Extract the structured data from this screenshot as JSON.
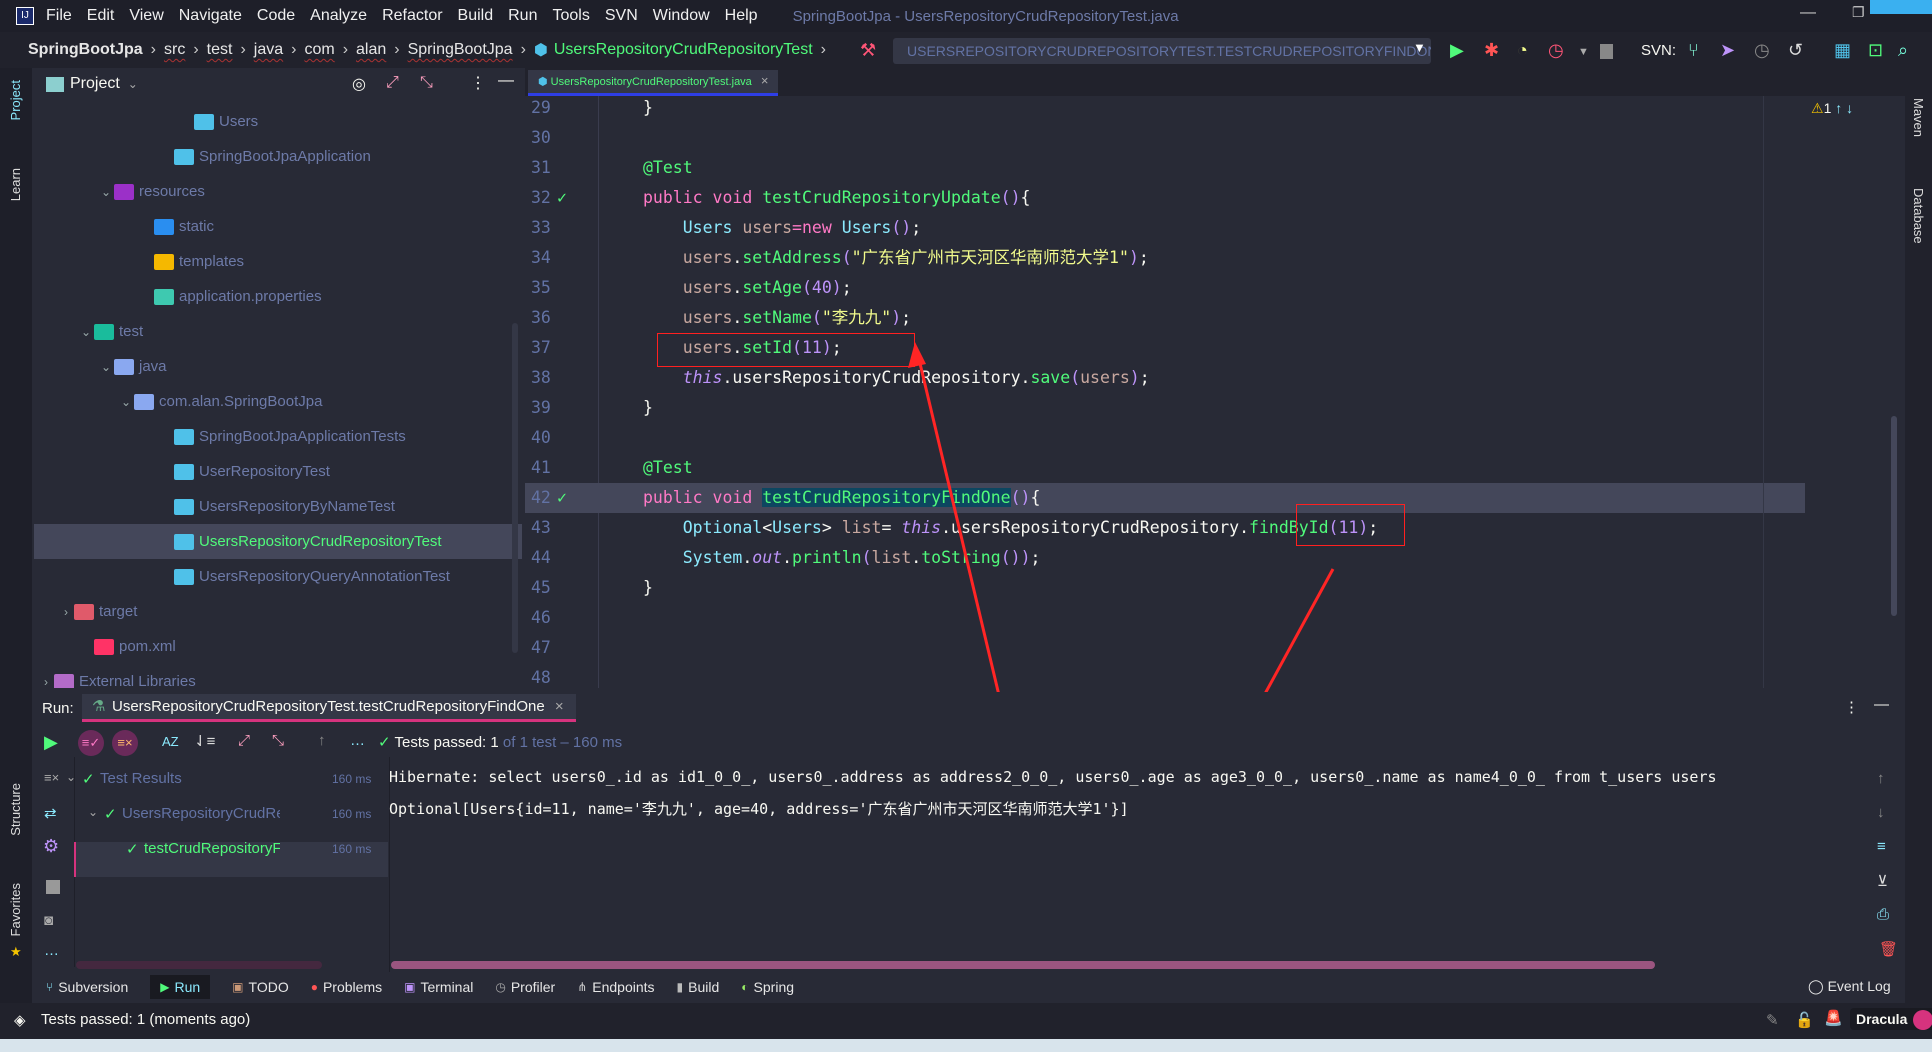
{
  "menu": {
    "items": [
      "File",
      "Edit",
      "View",
      "Navigate",
      "Code",
      "Analyze",
      "Refactor",
      "Build",
      "Run",
      "Tools",
      "SVN",
      "Window",
      "Help"
    ],
    "window_title": "SpringBootJpa - UsersRepositoryCrudRepositoryTest.java"
  },
  "breadcrumb": [
    "SpringBootJpa",
    "src",
    "test",
    "java",
    "com",
    "alan",
    "SpringBootJpa",
    "UsersRepositoryCrudRepositoryTest"
  ],
  "toolbar": {
    "run_config": "USERSREPOSITORYCRUDREPOSITORYTEST.TESTCRUDREPOSITORYFINDONE",
    "svn_label": "SVN:"
  },
  "left_stripe": {
    "project": "Project",
    "learn": "Learn",
    "structure": "Structure",
    "favorites": "Favorites"
  },
  "right_stripe": {
    "maven": "Maven",
    "database": "Database"
  },
  "project": {
    "title": "Project",
    "items": [
      {
        "label": "Users",
        "indent": 7,
        "icon": "class-icon",
        "color": "#4fc1e9"
      },
      {
        "label": "SpringBootJpaApplication",
        "indent": 6,
        "icon": "spring-class-icon",
        "color": "#4fc1e9"
      },
      {
        "label": "resources",
        "indent": 3,
        "chev": "v",
        "icon": "resources-folder-icon",
        "color": "#9b30c8"
      },
      {
        "label": "static",
        "indent": 5,
        "icon": "web-folder-icon",
        "color": "#2a8ef0"
      },
      {
        "label": "templates",
        "indent": 5,
        "icon": "templates-folder-icon",
        "color": "#f5b800"
      },
      {
        "label": "application.properties",
        "indent": 5,
        "icon": "properties-file-icon",
        "color": "#3ec9b0"
      },
      {
        "label": "test",
        "indent": 2,
        "chev": "v",
        "icon": "test-folder-icon",
        "color": "#1abc9c"
      },
      {
        "label": "java",
        "indent": 3,
        "chev": "v",
        "icon": "folder-icon",
        "color": "#8aa8f0"
      },
      {
        "label": "com.alan.SpringBootJpa",
        "indent": 4,
        "chev": "v",
        "icon": "package-icon",
        "color": "#8aa8f0"
      },
      {
        "label": "SpringBootJpaApplicationTests",
        "indent": 6,
        "icon": "test-class-icon",
        "color": "#4fc1e9"
      },
      {
        "label": "UserRepositoryTest",
        "indent": 6,
        "icon": "test-class-icon",
        "color": "#4fc1e9"
      },
      {
        "label": "UsersRepositoryByNameTest",
        "indent": 6,
        "icon": "test-class-icon",
        "color": "#4fc1e9"
      },
      {
        "label": "UsersRepositoryCrudRepositoryTest",
        "indent": 6,
        "icon": "test-class-icon",
        "color": "#4fc1e9",
        "selected": true
      },
      {
        "label": "UsersRepositoryQueryAnnotationTest",
        "indent": 6,
        "icon": "test-class-icon",
        "color": "#4fc1e9"
      },
      {
        "label": "target",
        "indent": 1,
        "chev": ">",
        "icon": "target-folder-icon",
        "color": "#e05a6a"
      },
      {
        "label": "pom.xml",
        "indent": 2,
        "icon": "maven-icon",
        "color": "#ff3366"
      },
      {
        "label": "External Libraries",
        "indent": 0,
        "chev": ">",
        "icon": "library-icon",
        "color": "#b36bc8"
      }
    ]
  },
  "editor": {
    "tab": "UsersRepositoryCrudRepositoryTest.java",
    "warnings": "1",
    "lines": [
      {
        "n": "29",
        "t": [
          [
            "p",
            "}"
          ]
        ]
      },
      {
        "n": "30",
        "t": []
      },
      {
        "n": "31",
        "t": [
          [
            "a",
            "@Test"
          ]
        ]
      },
      {
        "n": "32",
        "t": [
          [
            "k",
            "public void "
          ],
          [
            "f",
            "testCrudRepositoryUpdate"
          ],
          [
            "n",
            "()"
          ],
          [
            "p",
            "{"
          ]
        ],
        "mark": true
      },
      {
        "n": "33",
        "t": [
          [
            "c",
            "    Users "
          ],
          [
            "v",
            "users"
          ],
          [
            "k",
            "=new "
          ],
          [
            "c",
            "Users"
          ],
          [
            "n",
            "()"
          ],
          [
            "p",
            ";"
          ]
        ]
      },
      {
        "n": "34",
        "t": [
          [
            "v",
            "    users"
          ],
          [
            "p",
            "."
          ],
          [
            "f",
            "setAddress"
          ],
          [
            "n",
            "("
          ],
          [
            "s",
            "\"广东省广州市天河区华南师范大学1\""
          ],
          [
            "n",
            ")"
          ],
          [
            "p",
            ";"
          ]
        ]
      },
      {
        "n": "35",
        "t": [
          [
            "v",
            "    users"
          ],
          [
            "p",
            "."
          ],
          [
            "f",
            "setAge"
          ],
          [
            "n",
            "(40)"
          ],
          [
            "p",
            ";"
          ]
        ]
      },
      {
        "n": "36",
        "t": [
          [
            "v",
            "    users"
          ],
          [
            "p",
            "."
          ],
          [
            "f",
            "setName"
          ],
          [
            "n",
            "("
          ],
          [
            "s",
            "\"李九九\""
          ],
          [
            "n",
            ")"
          ],
          [
            "p",
            ";"
          ]
        ]
      },
      {
        "n": "37",
        "t": [
          [
            "v",
            "    users"
          ],
          [
            "p",
            "."
          ],
          [
            "f",
            "setId"
          ],
          [
            "n",
            "(11)"
          ],
          [
            "p",
            ";"
          ]
        ]
      },
      {
        "n": "38",
        "t": [
          [
            "i",
            "    this"
          ],
          [
            "p",
            ".usersRepositoryCrudRepository."
          ],
          [
            "f",
            "save"
          ],
          [
            "n",
            "("
          ],
          [
            "v",
            "users"
          ],
          [
            "n",
            ")"
          ],
          [
            "p",
            ";"
          ]
        ]
      },
      {
        "n": "39",
        "t": [
          [
            "p",
            "}"
          ]
        ]
      },
      {
        "n": "40",
        "t": []
      },
      {
        "n": "41",
        "t": [
          [
            "a",
            "@Test"
          ]
        ]
      },
      {
        "n": "42",
        "t": [
          [
            "k",
            "public void "
          ],
          [
            "f sel",
            "testCrudRepositoryFindOne"
          ],
          [
            "n",
            "()"
          ],
          [
            "p",
            "{"
          ]
        ],
        "mark": true,
        "highlight": true
      },
      {
        "n": "43",
        "t": [
          [
            "c",
            "    Optional"
          ],
          [
            "p",
            "<"
          ],
          [
            "c",
            "Users"
          ],
          [
            "p",
            "> "
          ],
          [
            "v",
            "list"
          ],
          [
            "p",
            "= "
          ],
          [
            "i",
            "this"
          ],
          [
            "p",
            ".usersRepositoryCrudRepository."
          ],
          [
            "f",
            "findById"
          ],
          [
            "n",
            "(11)"
          ],
          [
            "p",
            ";"
          ]
        ]
      },
      {
        "n": "44",
        "t": [
          [
            "c",
            "    System"
          ],
          [
            "p",
            "."
          ],
          [
            "i",
            "out"
          ],
          [
            "p",
            "."
          ],
          [
            "f",
            "println"
          ],
          [
            "n",
            "("
          ],
          [
            "v",
            "list"
          ],
          [
            "p",
            "."
          ],
          [
            "f",
            "toString"
          ],
          [
            "n",
            "()"
          ],
          [
            "n",
            ")"
          ],
          [
            "p",
            ";"
          ]
        ]
      },
      {
        "n": "45",
        "t": [
          [
            "p",
            "}"
          ]
        ]
      },
      {
        "n": "46",
        "t": []
      },
      {
        "n": "47",
        "t": []
      },
      {
        "n": "48",
        "t": []
      }
    ]
  },
  "run": {
    "label": "Run:",
    "tab": "UsersRepositoryCrudRepositoryTest.testCrudRepositoryFindOne",
    "status_passed": "Tests passed: ",
    "status_count": "1",
    "status_rest": " of 1 test – 160 ms",
    "tree": [
      {
        "label": "Test Results",
        "time": "160 ms"
      },
      {
        "label": "UsersRepositoryCrudRepos",
        "time": "160 ms"
      },
      {
        "label": "testCrudRepositoryFind(",
        "time": "160 ms"
      }
    ],
    "console": [
      "Hibernate: select users0_.id as id1_0_0_, users0_.address as address2_0_0_, users0_.age as age3_0_0_, users0_.name as name4_0_0_ from t_users users",
      "Optional[Users{id=11, name='李九九', age=40, address='广东省广州市天河区华南师范大学1'}]"
    ]
  },
  "bottom_tabs": [
    "Subversion",
    "Run",
    "TODO",
    "Problems",
    "Terminal",
    "Profiler",
    "Endpoints",
    "Build",
    "Spring"
  ],
  "event_log": "Event Log",
  "status": {
    "message": "Tests passed: 1 (moments ago)",
    "theme": "Dracula"
  },
  "colors": {
    "background": "#282a36",
    "accent": "#ff79c6",
    "function": "#50fa7b",
    "annotation_box": "#ff2020"
  }
}
